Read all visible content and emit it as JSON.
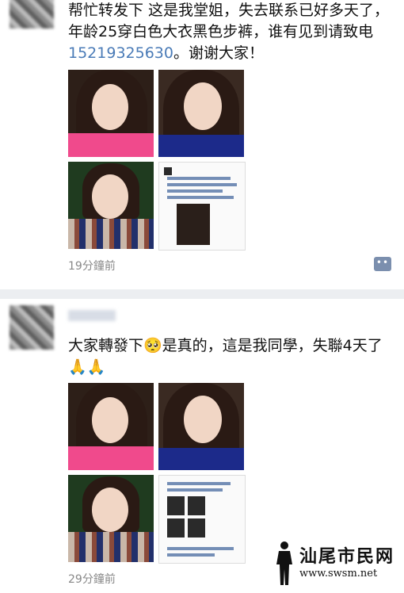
{
  "post1": {
    "text_a": "帮忙转发下  这是我堂姐，失去联系已好多天了，年龄25穿白色大衣黑色步裤，谁有见到请致电",
    "phone": "15219325630",
    "text_b": "。谢谢大家！",
    "time": "19分鐘前",
    "comment_icon": "comment-icon"
  },
  "post2": {
    "text": "大家轉發下🥺是真的，這是我同學，失聯4天了🙏🙏",
    "time": "29分鐘前"
  },
  "watermark": {
    "title": "汕尾市民网",
    "url": "www.swsm.net"
  }
}
